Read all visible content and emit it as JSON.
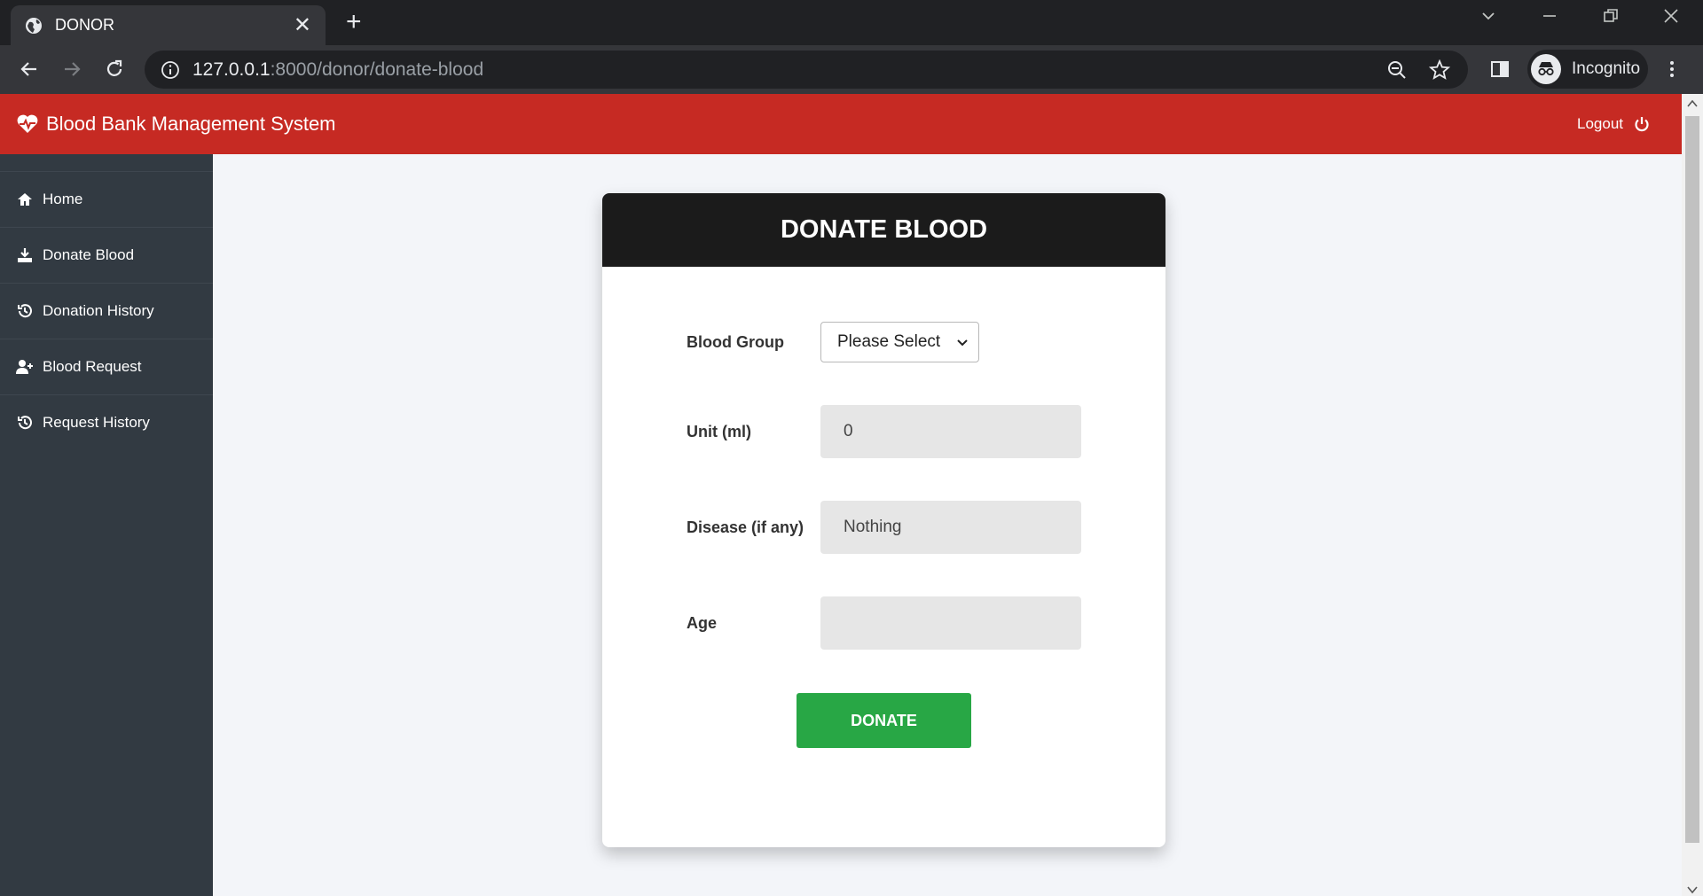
{
  "browser": {
    "tab_title": "DONOR",
    "url_host": "127.0.0.1",
    "url_path": ":8000/donor/donate-blood",
    "profile_label": "Incognito"
  },
  "topnav": {
    "brand": "Blood Bank Management System",
    "logout": "Logout"
  },
  "sidebar": {
    "items": [
      {
        "label": "Home",
        "icon": "home-icon"
      },
      {
        "label": "Donate Blood",
        "icon": "donate-icon"
      },
      {
        "label": "Donation History",
        "icon": "history-icon"
      },
      {
        "label": "Blood Request",
        "icon": "user-plus-icon"
      },
      {
        "label": "Request History",
        "icon": "history-icon"
      }
    ]
  },
  "form": {
    "title": "DONATE BLOOD",
    "blood_group_label": "Blood Group",
    "blood_group_value": "Please Select",
    "unit_label": "Unit (ml)",
    "unit_value": "0",
    "disease_label": "Disease (if any)",
    "disease_value": "Nothing",
    "age_label": "Age",
    "age_value": "",
    "submit_label": "DONATE"
  },
  "colors": {
    "topnav": "#c62a23",
    "sidebar": "#323a42",
    "card_header": "#1b1b1b",
    "donate_button": "#28a745"
  }
}
